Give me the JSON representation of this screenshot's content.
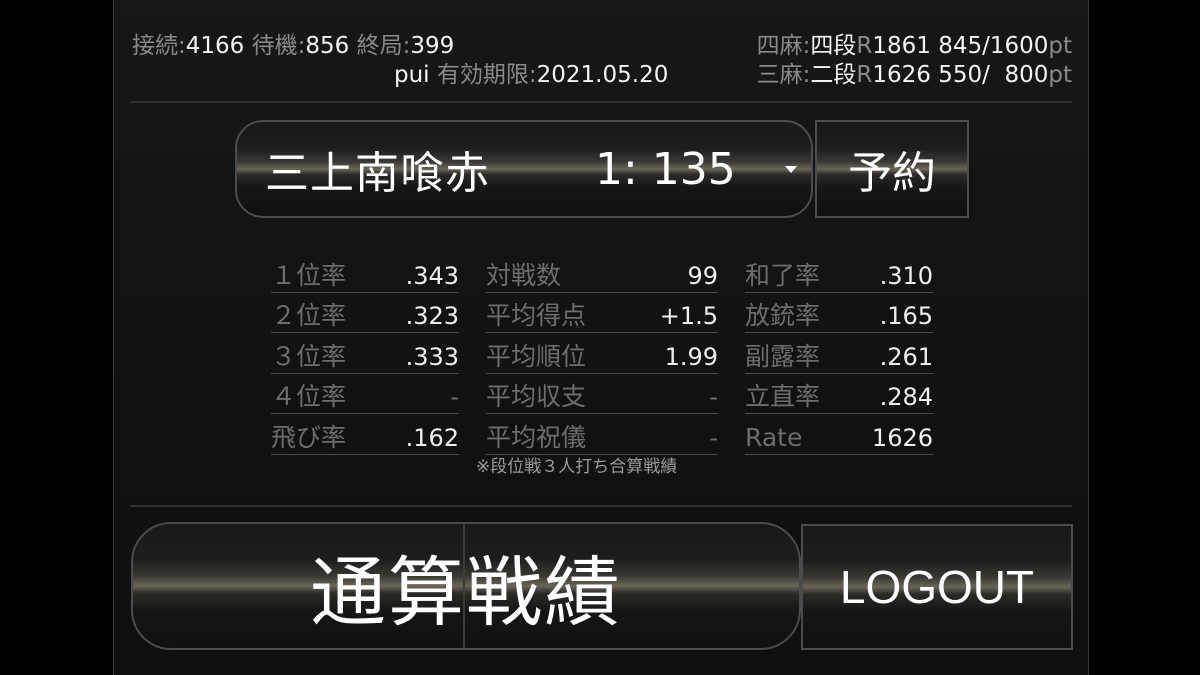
{
  "header": {
    "connected_label": "接続:",
    "connected_value": "4166",
    "waiting_label": "待機:",
    "waiting_value": "856",
    "finished_label": "終局:",
    "finished_value": "399",
    "user": "pui",
    "expiry_label": "有効期限:",
    "expiry_value": "2021.05.20",
    "four_player_label": "四麻:",
    "four_player_rank": "四段",
    "four_player_r_label": "R",
    "four_player_rating": "1861",
    "four_player_points": "845/1600",
    "four_player_unit": "pt",
    "three_player_label": "三麻:",
    "three_player_rank": "二段",
    "three_player_r_label": "R",
    "three_player_rating": "1626",
    "three_player_points": "550/  800",
    "three_player_unit": "pt"
  },
  "rule_select": {
    "name": "三上南喰赤",
    "count": "1: 135"
  },
  "reserve_label": "予約",
  "stats": {
    "col1": [
      {
        "label": "１位率",
        "value": ".343"
      },
      {
        "label": "２位率",
        "value": ".323"
      },
      {
        "label": "３位率",
        "value": ".333"
      },
      {
        "label": "４位率",
        "value": "-"
      },
      {
        "label": "飛び率",
        "value": ".162"
      }
    ],
    "col2": [
      {
        "label": "対戦数",
        "value": "99"
      },
      {
        "label": "平均得点",
        "value": "+1.5"
      },
      {
        "label": "平均順位",
        "value": "1.99"
      },
      {
        "label": "平均収支",
        "value": "-"
      },
      {
        "label": "平均祝儀",
        "value": "-"
      }
    ],
    "col3": [
      {
        "label": "和了率",
        "value": ".310"
      },
      {
        "label": "放銃率",
        "value": ".165"
      },
      {
        "label": "副露率",
        "value": ".261"
      },
      {
        "label": "立直率",
        "value": ".284"
      },
      {
        "label": "Rate",
        "value": "1626"
      }
    ],
    "note": "※段位戦３人打ち合算戦績"
  },
  "buttons": {
    "total_stats": "通算戦績",
    "logout": "LOGOUT"
  }
}
